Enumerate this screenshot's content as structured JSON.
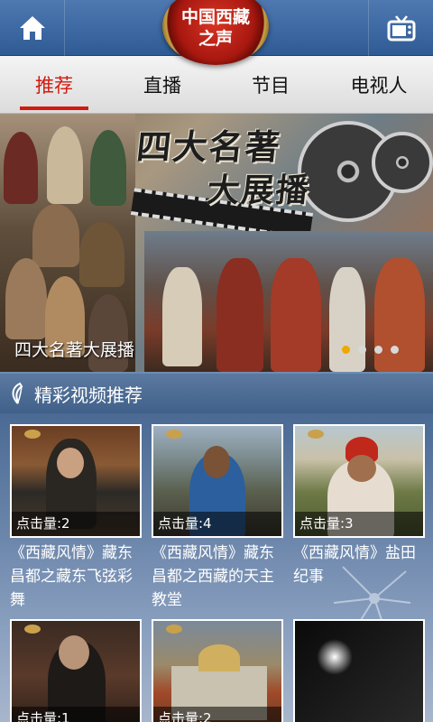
{
  "header": {
    "logo_line1": "中国西藏",
    "logo_line2": "之声",
    "home_icon": "home-icon",
    "tv_icon": "tv-icon"
  },
  "tabs": [
    {
      "label": "推荐",
      "active": true
    },
    {
      "label": "直播",
      "active": false
    },
    {
      "label": "节目",
      "active": false
    },
    {
      "label": "电视人",
      "active": false
    }
  ],
  "banner": {
    "title_line1": "四大名著",
    "title_line2": "大展播",
    "caption": "四大名著大展播",
    "slide_count": 4,
    "active_slide": 1
  },
  "section": {
    "icon": "leaf-icon",
    "title": "精彩视频推荐"
  },
  "videos": [
    {
      "clicks": "点击量:2",
      "title": "《西藏风情》藏东昌都之藏东飞弦彩舞"
    },
    {
      "clicks": "点击量:4",
      "title": "《西藏风情》藏东昌都之西藏的天主教堂"
    },
    {
      "clicks": "点击量:3",
      "title": "《西藏风情》盐田纪事"
    },
    {
      "clicks": "点击量:1",
      "title": ""
    },
    {
      "clicks": "点击量:2",
      "title": ""
    },
    {
      "clicks": "",
      "title": ""
    }
  ],
  "colors": {
    "accent_red": "#d21a10",
    "topbar_blue": "#2f5b95",
    "dot_active": "#f0a800"
  }
}
